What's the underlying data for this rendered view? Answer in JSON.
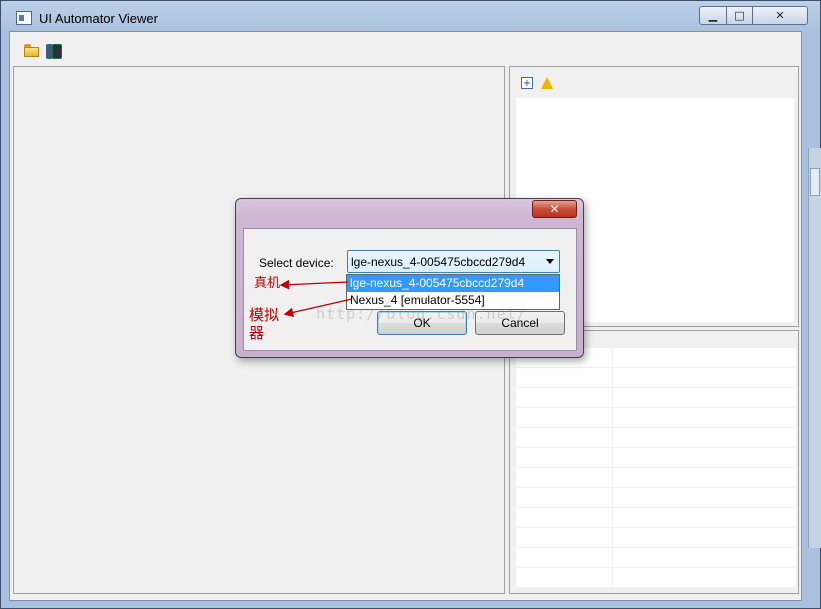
{
  "window": {
    "title": "UI Automator Viewer",
    "buttons": {
      "minimize": "▁",
      "maximize": "□",
      "close": "✕"
    }
  },
  "toolbar": {
    "open_icon": "folder-open-icon",
    "screenshot_icon": "device-screenshot-icon"
  },
  "right_panel": {
    "expand_icon": "expand-all-icon",
    "warning_icon": "warning-icon"
  },
  "dialog": {
    "close_label": "✕",
    "select_label": "Select device:",
    "selected_device": "lge-nexus_4-005475cbccd279d4",
    "options": [
      "lge-nexus_4-005475cbccd279d4",
      "Nexus_4 [emulator-5554]"
    ],
    "ok_label": "OK",
    "cancel_label": "Cancel"
  },
  "annotations": {
    "real_device": "真机",
    "emulator": "模拟器",
    "color": "#c00000"
  },
  "watermark": "http://blog.csdn.net/"
}
